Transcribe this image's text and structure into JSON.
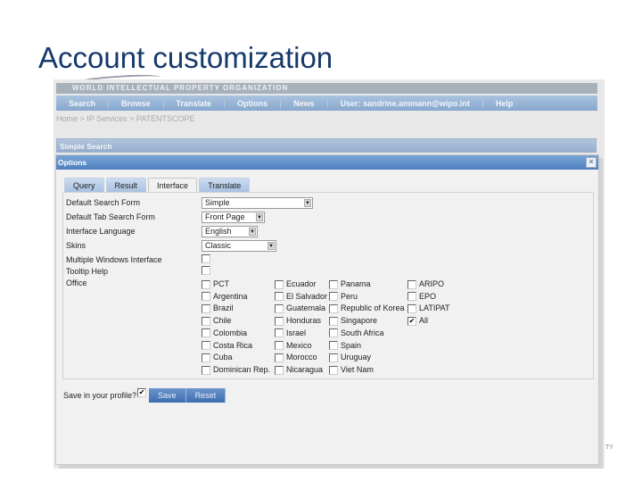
{
  "slide": {
    "title": "Account customization"
  },
  "header": {
    "org_name": "WORLD INTELLECTUAL PROPERTY ORGANIZATION",
    "nav": [
      "Search",
      "Browse",
      "Translate",
      "Options",
      "News",
      "User: sandrine.ammann@wipo.int",
      "Help"
    ],
    "breadcrumb": "Home > IP Services > PATENTSCOPE"
  },
  "simple_search": {
    "label": "Simple Search"
  },
  "dialog": {
    "title": "Options",
    "close_icon": "×",
    "tabs": [
      {
        "label": "Query",
        "active": false
      },
      {
        "label": "Result",
        "active": false
      },
      {
        "label": "Interface",
        "active": true
      },
      {
        "label": "Translate",
        "active": false
      }
    ],
    "fields": {
      "default_search_form": {
        "label": "Default Search Form",
        "value": "Simple"
      },
      "default_tab_search_form": {
        "label": "Default Tab Search Form",
        "value": "Front Page"
      },
      "interface_language": {
        "label": "Interface Language",
        "value": "English"
      },
      "skins": {
        "label": "Skins",
        "value": "Classic"
      },
      "multiple_windows": {
        "label": "Multiple Windows Interface",
        "checked": false
      },
      "tooltip_help": {
        "label": "Tooltip Help",
        "checked": false
      },
      "office": {
        "label": "Office"
      }
    },
    "arrow_glyph": "▼",
    "check_glyph": "✔",
    "offices": [
      [
        {
          "label": "PCT",
          "checked": false
        },
        {
          "label": "Argentina",
          "checked": false
        },
        {
          "label": "Brazil",
          "checked": false
        },
        {
          "label": "Chile",
          "checked": false
        },
        {
          "label": "Colombia",
          "checked": false
        },
        {
          "label": "Costa Rica",
          "checked": false
        },
        {
          "label": "Cuba",
          "checked": false
        },
        {
          "label": "Dominican Rep.",
          "checked": false
        }
      ],
      [
        {
          "label": "Ecuador",
          "checked": false
        },
        {
          "label": "El Salvador",
          "checked": false
        },
        {
          "label": "Guatemala",
          "checked": false
        },
        {
          "label": "Honduras",
          "checked": false
        },
        {
          "label": "Israel",
          "checked": false
        },
        {
          "label": "Mexico",
          "checked": false
        },
        {
          "label": "Morocco",
          "checked": false
        },
        {
          "label": "Nicaragua",
          "checked": false
        }
      ],
      [
        {
          "label": "Panama",
          "checked": false
        },
        {
          "label": "Peru",
          "checked": false
        },
        {
          "label": "Republic of Korea",
          "checked": false
        },
        {
          "label": "Singapore",
          "checked": false
        },
        {
          "label": "South Africa",
          "checked": false
        },
        {
          "label": "Spain",
          "checked": false
        },
        {
          "label": "Uruguay",
          "checked": false
        },
        {
          "label": "Viet Nam",
          "checked": false
        }
      ],
      [
        {
          "label": "ARIPO",
          "checked": false
        },
        {
          "label": "EPO",
          "checked": false
        },
        {
          "label": "LATIPAT",
          "checked": false
        },
        {
          "label": "All",
          "checked": true
        }
      ]
    ],
    "save_profile": {
      "label": "Save in your profile?",
      "checked": true
    },
    "buttons": {
      "save": "Save",
      "reset": "Reset"
    }
  },
  "footer": {
    "fragment": "TY"
  }
}
